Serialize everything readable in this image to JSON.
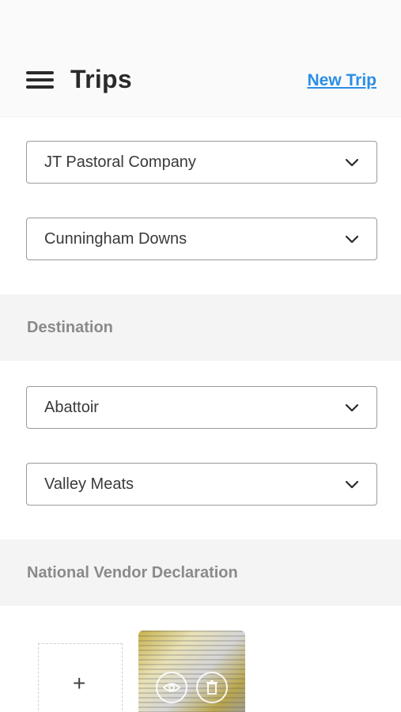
{
  "header": {
    "title": "Trips",
    "new_trip_label": "New Trip"
  },
  "origin": {
    "company": "JT Pastoral Company",
    "property": "Cunningham Downs"
  },
  "destination": {
    "section_label": "Destination",
    "type": "Abattoir",
    "place": "Valley Meats"
  },
  "nvd": {
    "section_label": "National Vendor Declaration",
    "add_label": "+"
  },
  "colors": {
    "accent": "#2a8ee6",
    "section_bg": "#f4f4f4",
    "section_text": "#8a8a8a"
  },
  "icons": [
    "menu-icon",
    "chevron-down-icon",
    "plus-icon",
    "eye-icon",
    "trash-icon"
  ]
}
